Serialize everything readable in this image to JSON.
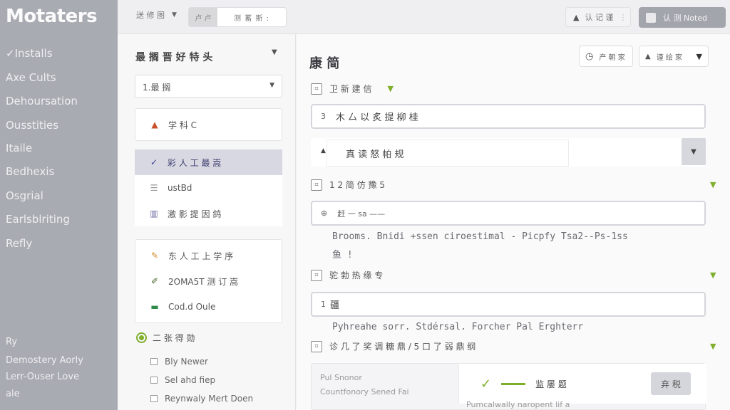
{
  "app": {
    "brand": "Motaters"
  },
  "leftnav": {
    "items": [
      "✓Installs",
      "Axe Cults",
      "Dehoursation",
      "Ousstities",
      "Itaile",
      "Bedhexis",
      "Osgrial",
      "Earlsblriting",
      "Refly"
    ],
    "footer": [
      "Ry",
      "Demostery Aorly",
      "Lerr-Ouser Love",
      "ale"
    ]
  },
  "topbar": {
    "dropdown_label": "送 修 图",
    "tab_a": "卢 卢",
    "tab_b": "测 蓄 斯 :",
    "user_label": "认 记 谨",
    "account_label": "认 测 Noted"
  },
  "midpanel": {
    "title": "最 搁 晋 好 特 头",
    "select_value": "1.最 搁",
    "list1": [
      {
        "icon": "triangle-icon",
        "label": "学 科 C",
        "active": false
      },
      {
        "icon": "check-icon",
        "label": "彩 人 工 最 嵩",
        "active": true
      },
      {
        "icon": "list-icon",
        "label": "ustBd",
        "active": false
      },
      {
        "icon": "chart-icon",
        "label": "激 影 提 因 鸽",
        "active": false
      }
    ],
    "list2": [
      {
        "icon": "edit-icon",
        "label": "东 人 工 上 学 序",
        "active": false
      },
      {
        "icon": "pen-icon",
        "label": "2OMA5T 测 订 嵩",
        "active": false
      },
      {
        "icon": "minus-icon",
        "label": "Cod.d Oule",
        "active": false
      }
    ],
    "check_section": {
      "title": "二 张 得 勋",
      "items": [
        "Bly Newer",
        "Sel ahd fiep",
        "Reynwaly Mert Doen"
      ]
    }
  },
  "main": {
    "title": "康 简",
    "btn1_label": "产 朝 家",
    "btn2_label": "谨 绘 家",
    "sections": [
      {
        "title": "卫 新 建 信",
        "field_prefix": "3",
        "field_value": "木 厶 以 炙 提 柳 桂"
      },
      {
        "title": "1 2 简 仿 豫 5",
        "field_prefix": "⊕",
        "field_value": "赶 一 sa ——",
        "description": "Brooms. Bnidi +ssen ciroestimal - Picpfy Tsa2--Ps-1ss",
        "description2": "鱼 !"
      },
      {
        "title": "驼 勃 热 缘 专",
        "field_prefix": "1",
        "field_value": "疆",
        "description": "Pyhreahe sorr. Stdérsal. Forcher Pal Erghterr"
      },
      {
        "title": "诊 几 了 奖 调 糖 鼎 / 5 口 了 弱 鼎 纲",
        "card_left_line1": "Pul Snonor",
        "card_left_line2": "Countfonory Sened Fai",
        "card_right_label": "监 屡 题",
        "card_btn": "弃 税",
        "card_foot": "Pumcalwally naropent lif a"
      }
    ],
    "select_row": {
      "label": "真  读 怒 帕 规"
    }
  }
}
